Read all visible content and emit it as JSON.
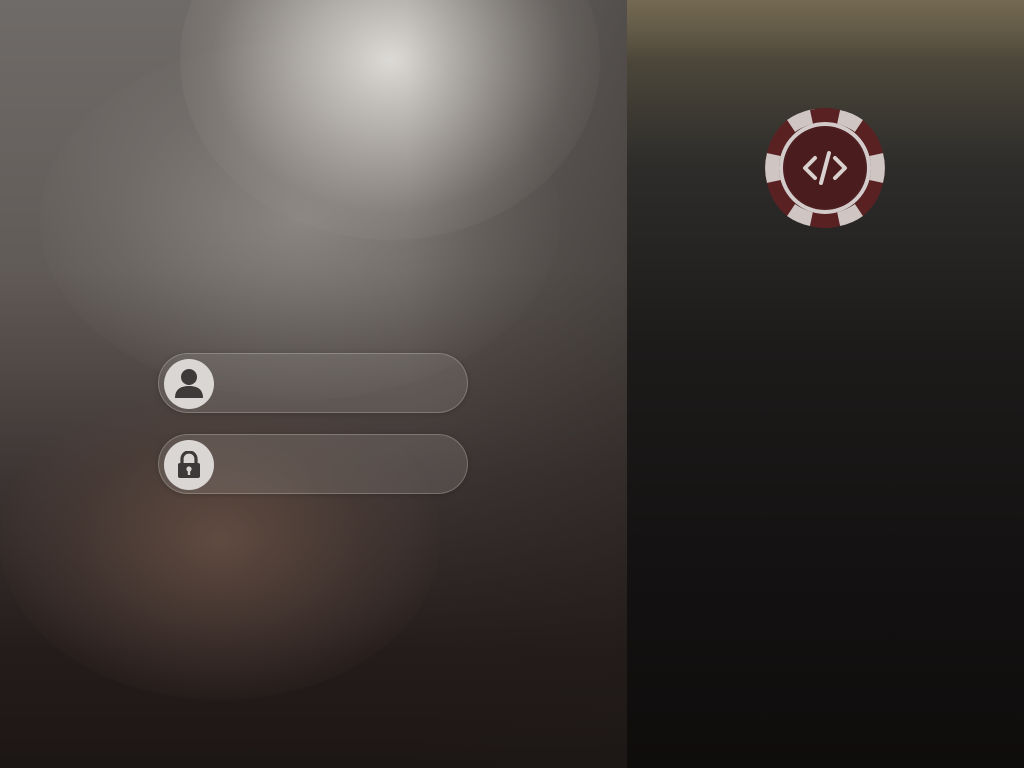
{
  "icons": {
    "username": "user-icon",
    "password": "lock-icon",
    "logo": "code-gear-logo-icon"
  },
  "login_form": {
    "username_value": "",
    "password_value": ""
  },
  "colors": {
    "left_panel_bright": "#e2e0dc",
    "right_panel_dark": "#131111",
    "logo_ring": "#5c2426",
    "logo_light": "#d9d1cf",
    "icon_circle": "#d9d6d4",
    "icon_glyph": "#3e3a39"
  }
}
